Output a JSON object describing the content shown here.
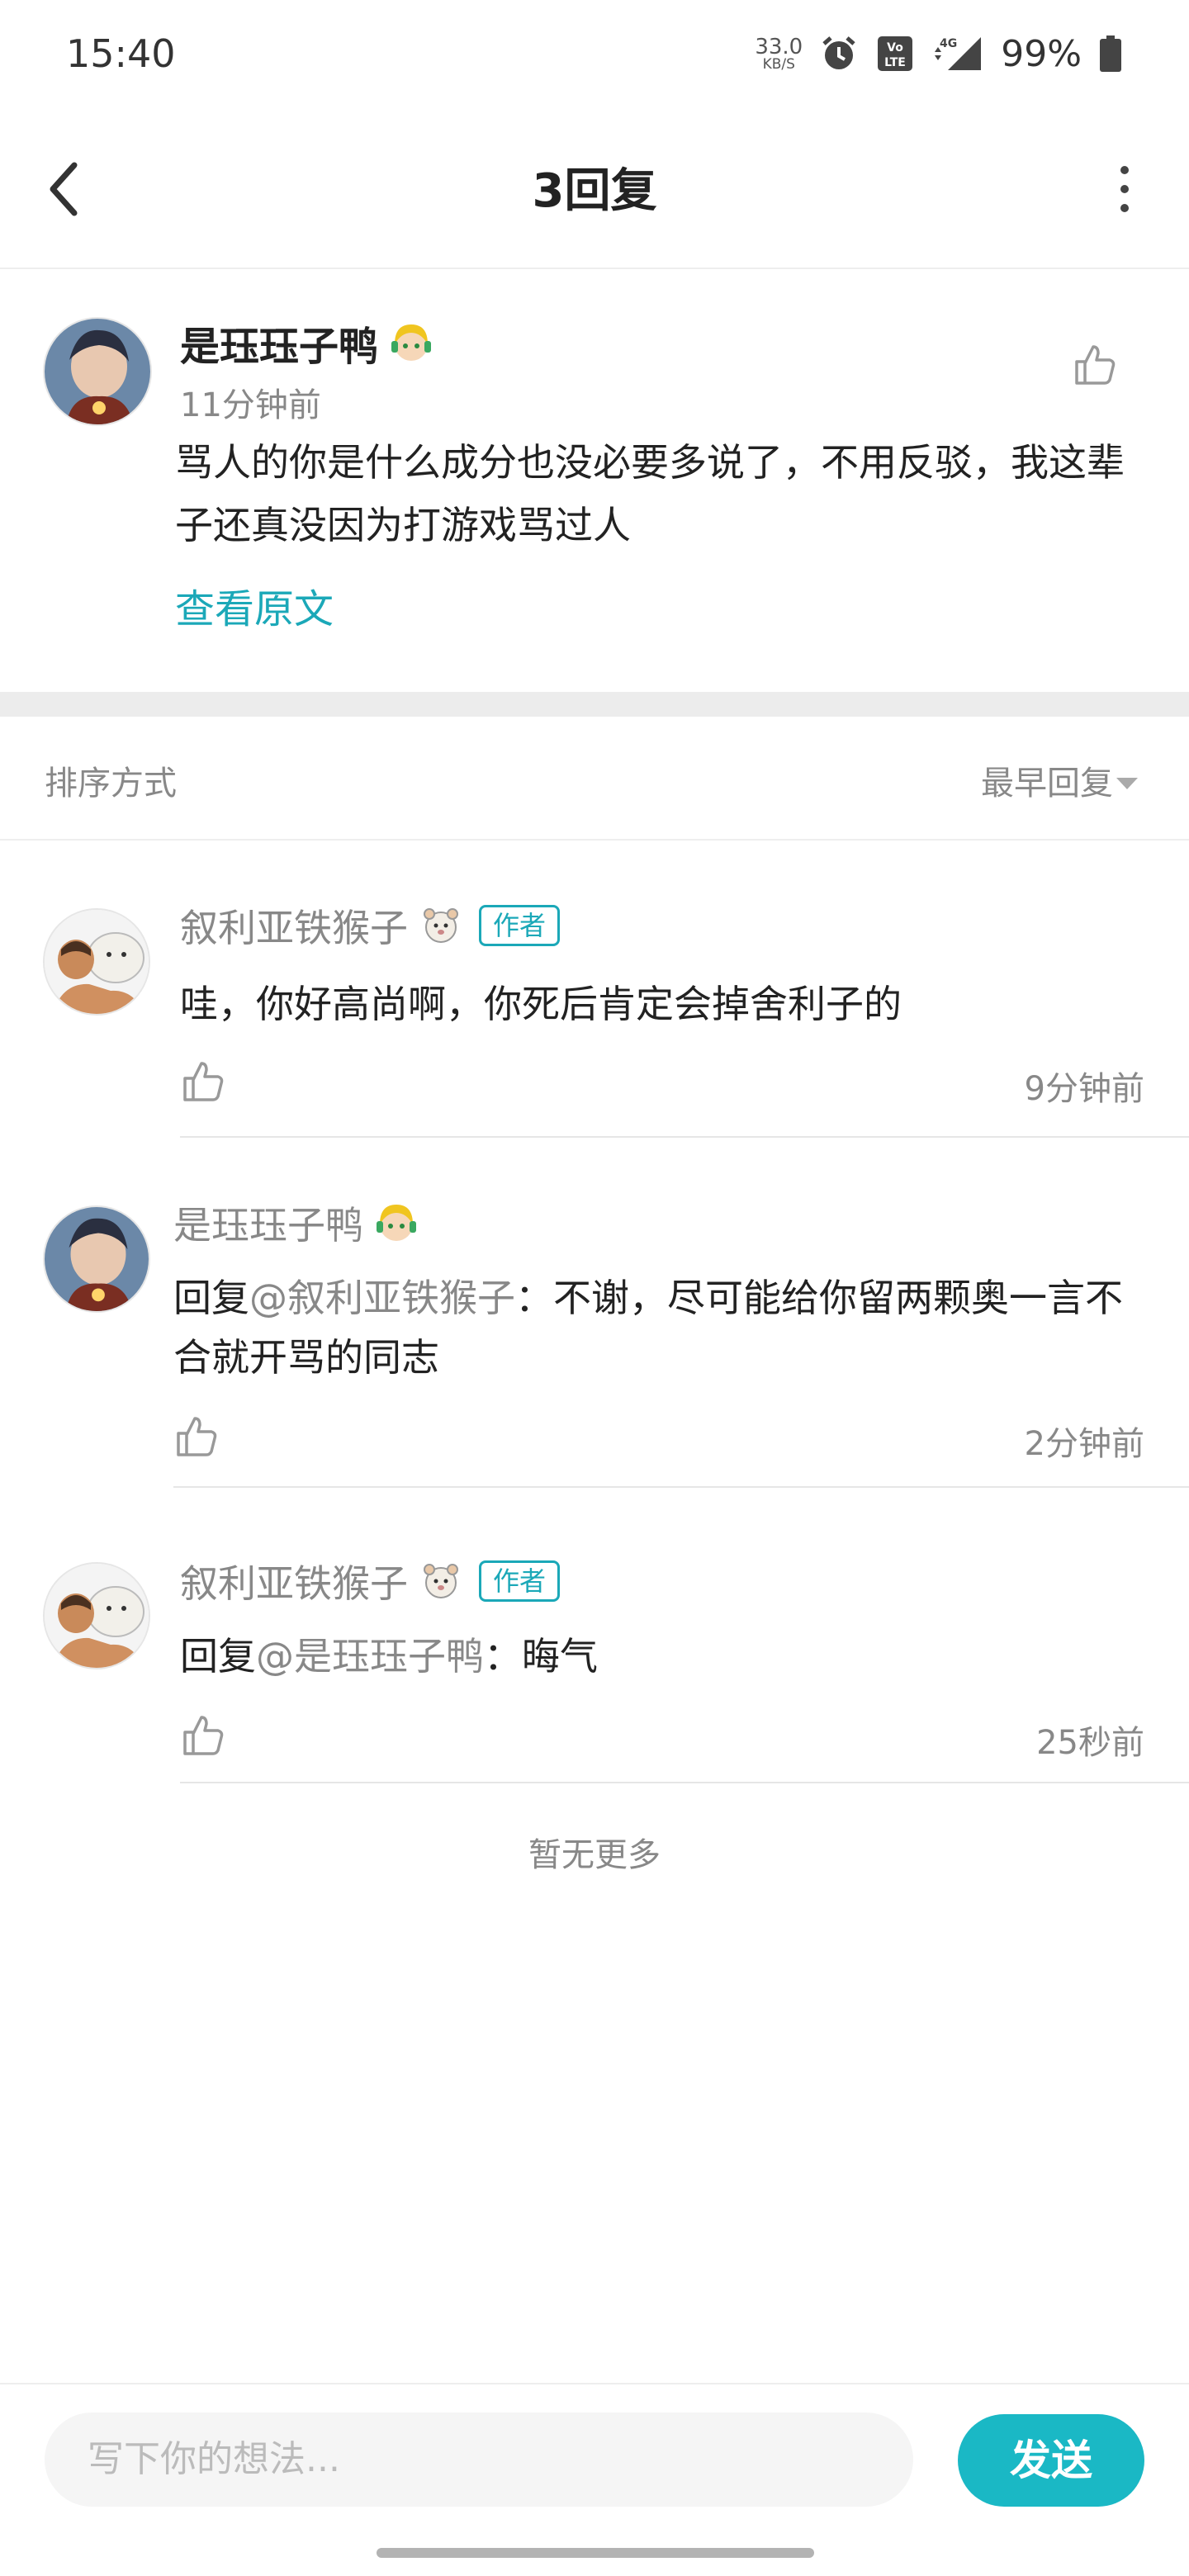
{
  "status_bar": {
    "time": "15:40",
    "net_speed_value": "33.0",
    "net_speed_unit": "KB/S",
    "battery": "99%",
    "icons": [
      "alarm-icon",
      "volte-icon",
      "signal-4g-icon",
      "battery-icon"
    ]
  },
  "header": {
    "title": "3回复",
    "back_icon": "back-arrow-icon",
    "more_icon": "more-vertical-icon"
  },
  "main_post": {
    "author": "是珏珏子鸭",
    "time": "11分钟前",
    "content": "骂人的你是什么成分也没必要多说了，不用反驳，我这辈子还真没因为打游戏骂过人",
    "view_original": "查看原文"
  },
  "sort": {
    "label": "排序方式",
    "value": "最早回复"
  },
  "replies": [
    {
      "author": "叙利亚铁猴子",
      "badge": "作者",
      "mention": "",
      "content": "哇，你好高尚啊，你死后肯定会掉舍利子的",
      "time": "9分钟前"
    },
    {
      "author": "是珏珏子鸭",
      "badge": "",
      "reply_prefix": "回复",
      "mention": "@叙利亚铁猴子",
      "content": "：不谢，尽可能给你留两颗奥一言不合就开骂的同志",
      "time": "2分钟前"
    },
    {
      "author": "叙利亚铁猴子",
      "badge": "作者",
      "reply_prefix": "回复",
      "mention": "@是珏珏子鸭",
      "content": "：晦气",
      "time": "25秒前"
    }
  ],
  "no_more": "暂无更多",
  "input": {
    "placeholder": "写下你的想法...",
    "send": "发送"
  },
  "colors": {
    "accent": "#1ba8b8",
    "send_button": "#1ab8c5",
    "muted_text": "#888888"
  }
}
